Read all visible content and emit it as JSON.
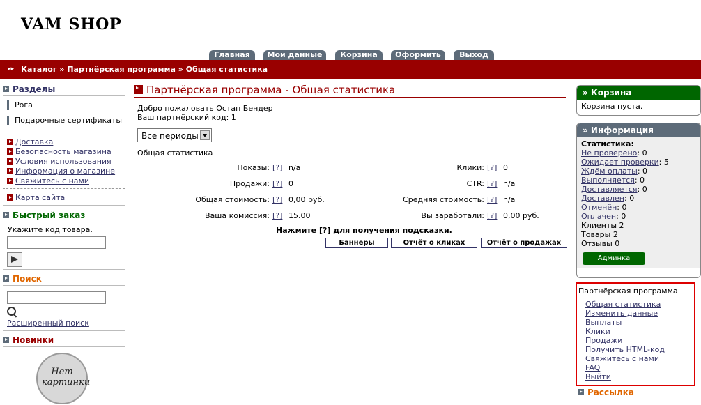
{
  "header": {
    "logo": "VAM SHOP",
    "tabs": [
      "Главная",
      "Мои данные",
      "Корзина",
      "Оформить",
      "Выход"
    ],
    "breadcrumb": "Каталог » Партнёрская программа » Общая статистика"
  },
  "left": {
    "sections_title": "Разделы",
    "categories": [
      "Рога",
      "Подарочные сертификаты"
    ],
    "info_links": [
      "Доставка",
      "Безопасность магазина",
      "Условия использования",
      "Информация о магазине",
      "Свяжитесь с нами"
    ],
    "sitemap": "Карта сайта",
    "quick_title": "Быстрый заказ",
    "quick_label": "Укажите код товара.",
    "search_title": "Поиск",
    "advanced_search": "Расширенный поиск",
    "news_title": "Новинки",
    "no_picture": "Нет картинки"
  },
  "main": {
    "title": "Партнёрская программа - Общая статистика",
    "welcome": "Добро пожаловать Остап Бендер",
    "code": "Ваш партнёрский код: 1",
    "period": "Все периоды",
    "stats_title": "Общая статистика",
    "help_mark": "[?]",
    "stats": [
      {
        "label": "Показы:",
        "value": "n/a"
      },
      {
        "label": "Клики:",
        "value": "0"
      },
      {
        "label": "Продажи:",
        "value": "0"
      },
      {
        "label": "CTR:",
        "value": "n/a"
      },
      {
        "label": "Общая стоимость:",
        "value": "0,00 руб."
      },
      {
        "label": "Средняя стоимость:",
        "value": "n/a"
      },
      {
        "label": "Ваша комиссия:",
        "value": "15.00"
      },
      {
        "label": "Вы заработали:",
        "value": "0,00 руб."
      }
    ],
    "hint": "Нажмите [?] для получения подсказки.",
    "buttons": [
      "Баннеры",
      "Отчёт о кликах",
      "Отчёт о продажах"
    ]
  },
  "right": {
    "cart_title": "» Корзина",
    "cart_empty": "Корзина пуста.",
    "info_title": "» Информация",
    "stats_label": "Статистика:",
    "order_stats": [
      {
        "label": "Не проверено",
        "value": "0"
      },
      {
        "label": "Ожидает проверки",
        "value": "5"
      },
      {
        "label": "Ждём оплаты",
        "value": "0"
      },
      {
        "label": "Выполняется",
        "value": "0"
      },
      {
        "label": "Доставляется",
        "value": "0"
      },
      {
        "label": "Доставлен",
        "value": "0"
      },
      {
        "label": "Отменён",
        "value": "0"
      },
      {
        "label": "Оплачен",
        "value": "0"
      }
    ],
    "clients": "Клиенты 2",
    "products": "Товары 2",
    "reviews": "Отзывы 0",
    "admin_button": "Админка",
    "affiliate_title": "Партнёрская программа",
    "affiliate_links": [
      "Общая статистика",
      "Изменить данные",
      "Выплаты",
      "Клики",
      "Продажи",
      "Получить HTML-код",
      "Свяжитесь с нами",
      "FAQ",
      "Выйти"
    ],
    "mailing_title": "Рассылка"
  }
}
